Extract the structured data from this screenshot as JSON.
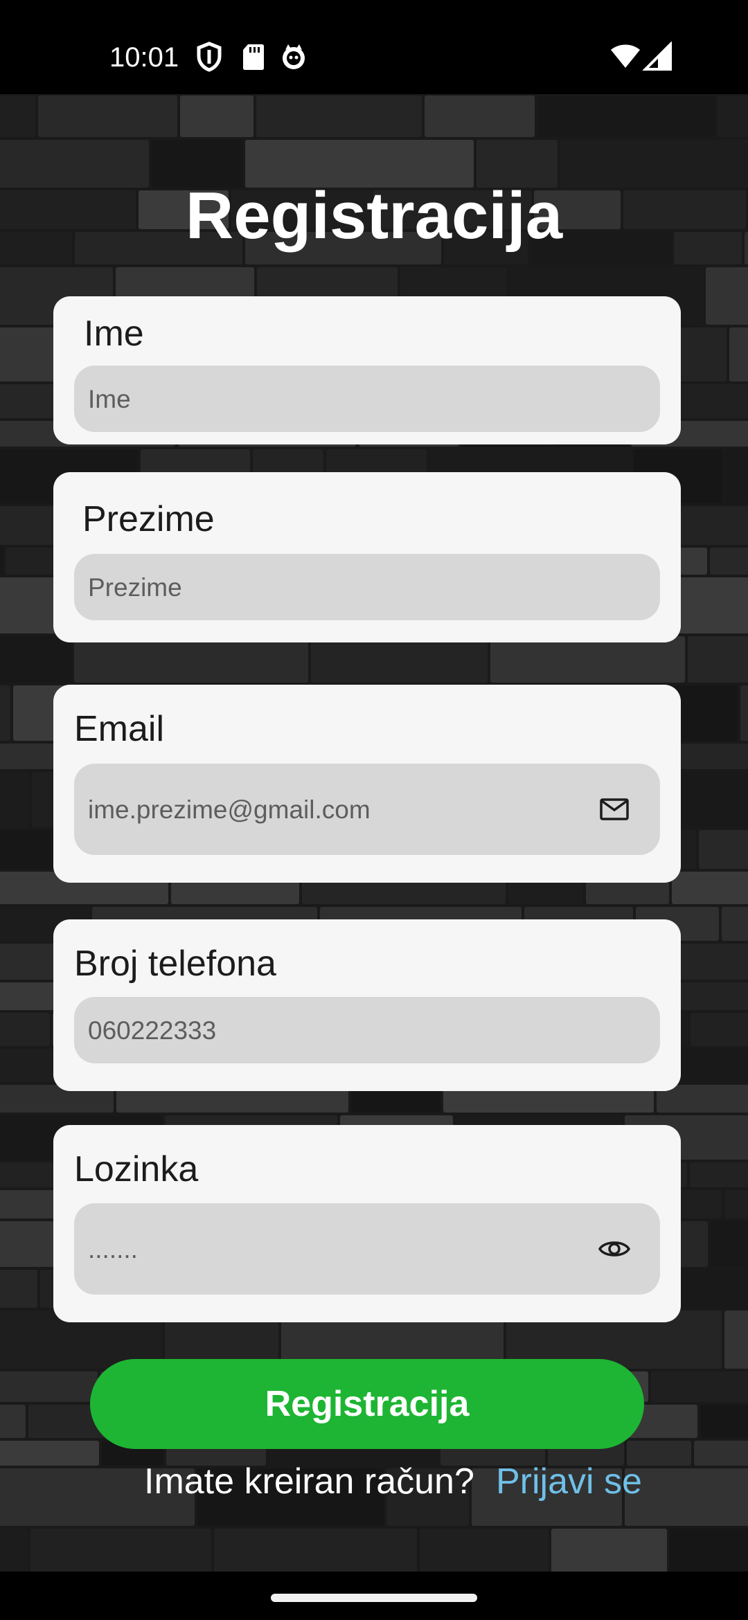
{
  "status_bar": {
    "time": "10:01",
    "left_icons": [
      "shield-icon",
      "sd-card-icon",
      "app-face-icon"
    ],
    "right_icons": [
      "wifi-icon",
      "cell-signal-icon"
    ]
  },
  "page": {
    "title": "Registracija"
  },
  "form": {
    "first_name": {
      "label": "Ime",
      "placeholder": "Ime"
    },
    "last_name": {
      "label": "Prezime",
      "placeholder": "Prezime"
    },
    "email": {
      "label": "Email",
      "placeholder": "ime.prezime@gmail.com",
      "icon": "mail-icon"
    },
    "phone": {
      "label": "Broj telefona",
      "placeholder": "060222333"
    },
    "password": {
      "label": "Lozinka",
      "placeholder": ".......",
      "icon": "eye-icon"
    }
  },
  "actions": {
    "register_label": "Registracija",
    "login_prompt": "Imate kreiran račun?",
    "login_link": "Prijavi se"
  },
  "colors": {
    "accent_button": "#1db533",
    "link": "#6fc0e8",
    "card": "#f6f6f6",
    "field": "#d7d7d7"
  }
}
